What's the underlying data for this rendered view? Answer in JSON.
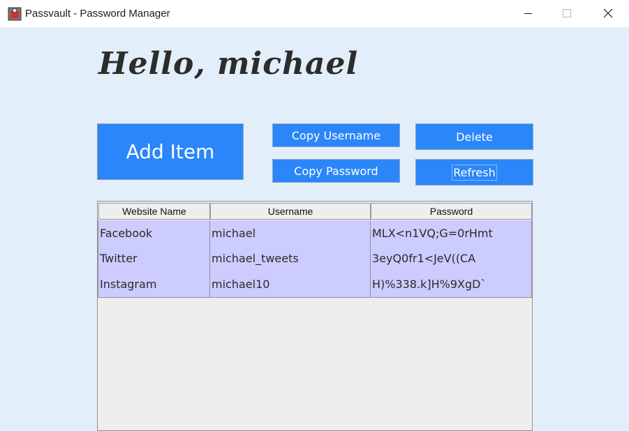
{
  "window": {
    "title": "Passvault - Password Manager",
    "icon": "app-icon"
  },
  "greeting": "Hello, michael",
  "buttons": {
    "add_item": "Add Item",
    "copy_username": "Copy Username",
    "copy_password": "Copy Password",
    "delete": "Delete",
    "refresh": "Refresh"
  },
  "table": {
    "headers": [
      "Website Name",
      "Username",
      "Password"
    ],
    "rows": [
      [
        "Facebook",
        "michael",
        "MLX<n1VQ;G=0rHmt"
      ],
      [
        "Twitter",
        "michael_tweets",
        "3eyQ0fr1<JeV((CA"
      ],
      [
        "Instagram",
        "michael10",
        "H)%338.k]H%9XgD`"
      ]
    ]
  },
  "colors": {
    "background": "#e2effa",
    "button": "#2b86f9",
    "row": "#ccccff"
  }
}
